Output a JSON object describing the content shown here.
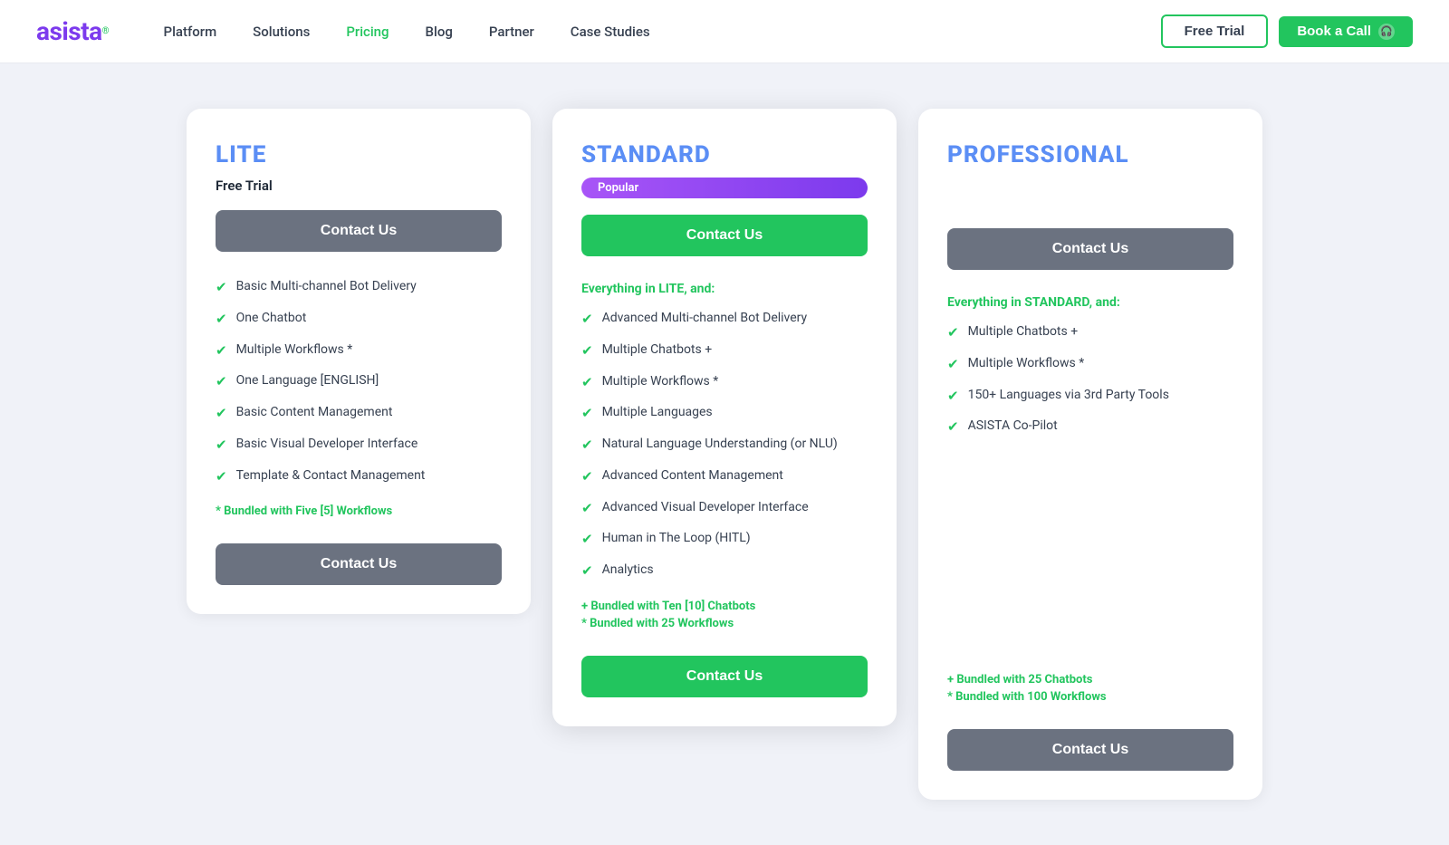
{
  "brand": {
    "name": "asista",
    "logo_symbol": "®"
  },
  "nav": {
    "links": [
      {
        "label": "Platform",
        "active": false
      },
      {
        "label": "Solutions",
        "active": false
      },
      {
        "label": "Pricing",
        "active": true
      },
      {
        "label": "Blog",
        "active": false
      },
      {
        "label": "Partner",
        "active": false
      },
      {
        "label": "Case Studies",
        "active": false
      }
    ],
    "free_trial": "Free Trial",
    "book_a_call": "Book a Call"
  },
  "plans": [
    {
      "id": "lite",
      "tier": "LITE",
      "subtitle": "Free Trial",
      "featured": false,
      "popular": false,
      "contact_label": "Contact Us",
      "section_label": null,
      "features": [
        "Basic Multi-channel Bot Delivery",
        "One Chatbot",
        "Multiple Workflows *",
        "One Language [ENGLISH]",
        "Basic Content Management",
        "Basic Visual Developer Interface",
        "Template & Contact Management"
      ],
      "bundle_notes": [
        "* Bundled with Five [5] Workflows"
      ]
    },
    {
      "id": "standard",
      "tier": "STANDARD",
      "subtitle": null,
      "featured": true,
      "popular": true,
      "popular_label": "Popular",
      "contact_label": "Contact Us",
      "section_label": "Everything in LITE, and:",
      "features": [
        "Advanced Multi-channel Bot Delivery",
        "Multiple Chatbots +",
        "Multiple Workflows *",
        "Multiple Languages",
        "Natural Language Understanding (or NLU)",
        "Advanced Content Management",
        "Advanced Visual Developer Interface",
        "Human in The Loop (HITL)",
        "Analytics"
      ],
      "bundle_notes": [
        "+ Bundled with Ten [10] Chatbots",
        "* Bundled with 25 Workflows"
      ]
    },
    {
      "id": "professional",
      "tier": "PROFESSIONAL",
      "subtitle": null,
      "featured": false,
      "popular": false,
      "contact_label": "Contact Us",
      "section_label": "Everything in STANDARD, and:",
      "features": [
        "Multiple Chatbots +",
        "Multiple Workflows *",
        "150+ Languages via 3rd Party Tools",
        "ASISTA Co-Pilot"
      ],
      "bundle_notes": [
        "+ Bundled with 25 Chatbots",
        "* Bundled with 100 Workflows"
      ]
    }
  ]
}
